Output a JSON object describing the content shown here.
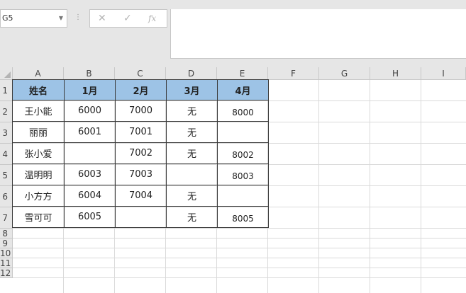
{
  "name_box": {
    "value": "G5"
  },
  "formula_buttons": {
    "cancel": "✕",
    "enter": "✓",
    "fx": "fx"
  },
  "formula_bar": {
    "value": ""
  },
  "columns": [
    "A",
    "B",
    "C",
    "D",
    "E",
    "F",
    "G",
    "H",
    "I"
  ],
  "rows": [
    "1",
    "2",
    "3",
    "4",
    "5",
    "6",
    "7",
    "8",
    "9",
    "10",
    "11",
    "12"
  ],
  "table": {
    "headers": [
      "姓名",
      "1月",
      "2月",
      "3月",
      "4月"
    ],
    "rows": [
      [
        "王小能",
        "6000",
        "7000",
        "无",
        "8000"
      ],
      [
        "丽丽",
        "6001",
        "7001",
        "无",
        ""
      ],
      [
        "张小爱",
        "",
        "7002",
        "无",
        "8002"
      ],
      [
        "温明明",
        "6003",
        "7003",
        "",
        "8003"
      ],
      [
        "小方方",
        "6004",
        "7004",
        "无",
        ""
      ],
      [
        "雪可可",
        "6005",
        "",
        "无",
        "8005"
      ]
    ]
  },
  "colors": {
    "header_fill": "#9dc3e6",
    "chrome": "#e6e6e6"
  }
}
